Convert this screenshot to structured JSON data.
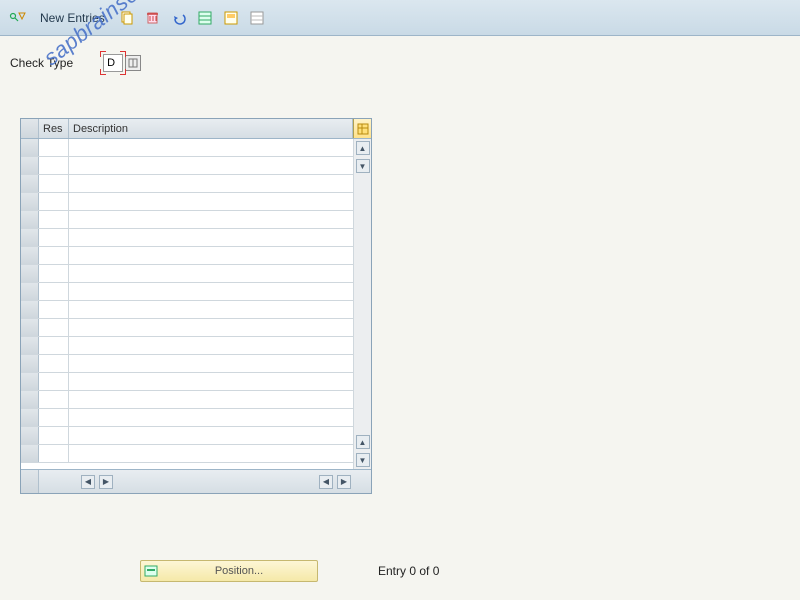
{
  "toolbar": {
    "new_entries_label": "New Entries"
  },
  "field": {
    "label": "Check Type",
    "value": "D"
  },
  "grid": {
    "columns": {
      "res": "Res",
      "desc": "Description"
    },
    "row_count": 18
  },
  "footer": {
    "position_label": "Position...",
    "entry_text": "Entry 0 of 0"
  },
  "watermark": "sapbrainsonline.com"
}
